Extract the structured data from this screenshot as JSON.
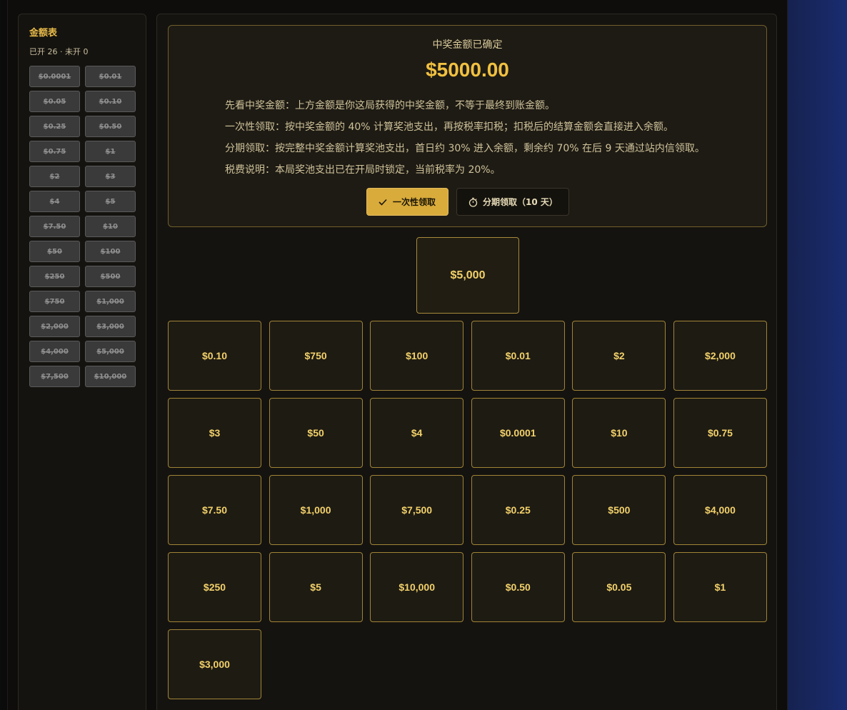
{
  "top_caption": "",
  "sidebar": {
    "title": "金额表",
    "stats": "已开 26 · 未开 0",
    "amounts": [
      "$0.0001",
      "$0.01",
      "$0.05",
      "$0.10",
      "$0.25",
      "$0.50",
      "$0.75",
      "$1",
      "$2",
      "$3",
      "$4",
      "$5",
      "$7.50",
      "$10",
      "$50",
      "$100",
      "$250",
      "$500",
      "$750",
      "$1,000",
      "$2,000",
      "$3,000",
      "$4,000",
      "$5,000",
      "$7,500",
      "$10,000"
    ]
  },
  "result": {
    "heading": "中奖金额已确定",
    "amount": "$5000.00",
    "lines": [
      "先看中奖金额：上方金额是你这局获得的中奖金额，不等于最终到账金额。",
      "一次性领取：按中奖金额的 40% 计算奖池支出，再按税率扣税；扣税后的结算金额会直接进入余额。",
      "分期领取：按完整中奖金额计算奖池支出，首日约 30% 进入余额，剩余约 70% 在后 9 天通过站内信领取。",
      "税费说明：本局奖池支出已在开局时锁定，当前税率为 20%。"
    ],
    "lump_sum_label": "一次性领取",
    "installment_label": "分期领取（10 天）"
  },
  "player_box": "$5,000",
  "boxes": [
    "$0.10",
    "$750",
    "$100",
    "$0.01",
    "$2",
    "$2,000",
    "$3",
    "$50",
    "$4",
    "$0.0001",
    "$10",
    "$0.75",
    "$7.50",
    "$1,000",
    "$7,500",
    "$0.25",
    "$500",
    "$4,000",
    "$250",
    "$5",
    "$10,000",
    "$0.50",
    "$0.05",
    "$1",
    "$3,000"
  ],
  "colors": {
    "accent": "#d9ab3b",
    "gold_text": "#f2d16a",
    "box_border": "#a08436"
  }
}
